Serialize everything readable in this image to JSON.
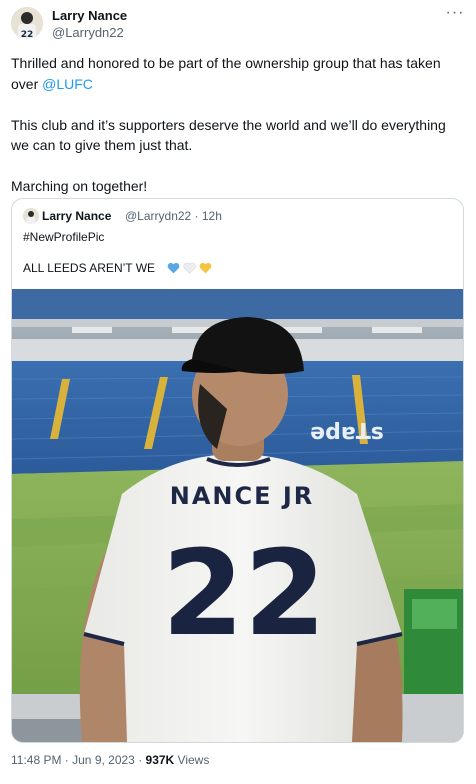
{
  "author": {
    "name": "Larry Nance",
    "handle": "@Larrydn22",
    "avatar_icon": "avatar-photo-icon",
    "more_icon": "more-options-icon"
  },
  "tweet": {
    "line1_text": "Thrilled and honored to be part of the ownership group that has taken over ",
    "mention": "@LUFC",
    "line2_text": "This club and it’s supporters deserve the world and we’ll do everything we can to give them just that.",
    "line3_text": "Marching on together!"
  },
  "quoted_tweet": {
    "name": "Larry Nance",
    "handle_time": "@Larrydn22 · 12h",
    "text_line1": "#NewProfilePic",
    "text_line2": "ALL LEEDS AREN’T WE",
    "hearts": [
      "blue-heart-icon",
      "white-heart-icon",
      "yellow-heart-icon"
    ],
    "image": {
      "jersey_name": "NANCE JR",
      "jersey_number": "22",
      "stadium_letters": "ədɐꓕs"
    }
  },
  "meta": {
    "time_date": "11:48 PM · Jun 9, 2023 · ",
    "views_count": "937K",
    "views_label": " Views"
  },
  "colors": {
    "link": "#1d9bf0",
    "secondary_text": "#536471",
    "border": "#cfd9de",
    "heart_blue": "#5aa7e6",
    "heart_white": "#e7e9ea",
    "heart_yellow": "#f5c542"
  }
}
